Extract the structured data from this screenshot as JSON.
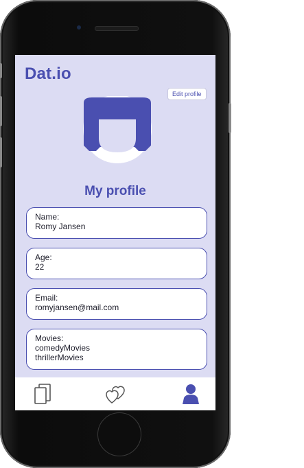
{
  "app": {
    "brand": "Dat.io"
  },
  "header": {
    "edit_label": "Edit profile"
  },
  "profile": {
    "title": "My profile",
    "fields": [
      {
        "label": "Name:",
        "values": [
          "Romy Jansen"
        ]
      },
      {
        "label": "Age:",
        "values": [
          "22"
        ]
      },
      {
        "label": "Email:",
        "values": [
          "romyjansen@mail.com"
        ]
      },
      {
        "label": "Movies:",
        "values": [
          "comedyMovies",
          "thrillerMovies"
        ]
      }
    ]
  },
  "tabbar": {
    "items": [
      {
        "icon": "cards-icon",
        "active": false
      },
      {
        "icon": "hearts-icon",
        "active": false
      },
      {
        "icon": "person-icon",
        "active": true
      }
    ]
  },
  "colors": {
    "accent": "#4a4fb0",
    "screen_bg": "#dcdcf3",
    "card_bg": "#ffffff"
  }
}
